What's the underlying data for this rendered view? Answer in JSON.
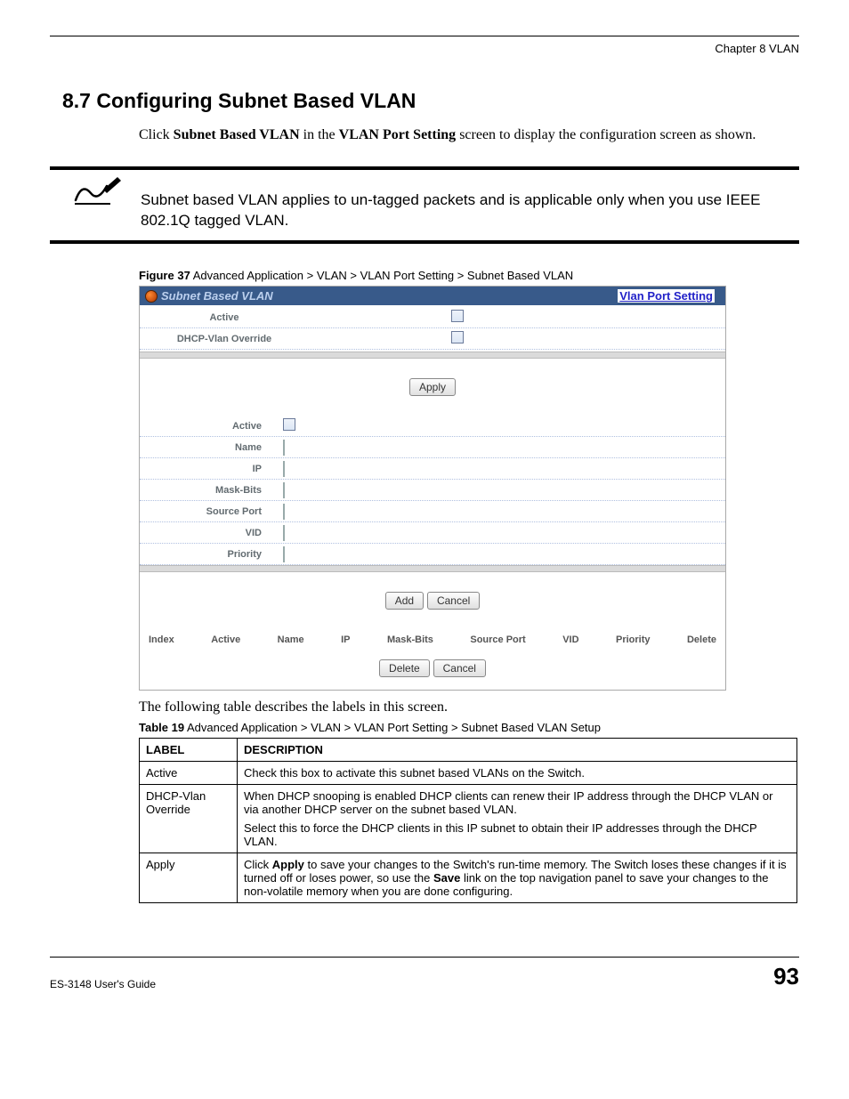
{
  "header": {
    "chapter": "Chapter 8 VLAN"
  },
  "section": {
    "number_title": "8.7  Configuring Subnet Based VLAN",
    "intro_click": "Click ",
    "intro_bold1": "Subnet Based VLAN",
    "intro_mid": " in the ",
    "intro_bold2": "VLAN Port Setting",
    "intro_tail": " screen to display the configuration screen as shown."
  },
  "note": {
    "text": "Subnet based VLAN applies to un-tagged packets and is applicable only when you use IEEE 802.1Q tagged VLAN."
  },
  "figure": {
    "label": "Figure 37",
    "caption": "   Advanced Application > VLAN > VLAN Port Setting > Subnet Based VLAN"
  },
  "screenshot": {
    "title_left": "Subnet Based VLAN",
    "title_right": "Vlan Port Setting",
    "form1": {
      "r1": "Active",
      "r2": "DHCP-Vlan Override"
    },
    "btn_apply": "Apply",
    "form2": {
      "r1": "Active",
      "r2": "Name",
      "r3": "IP",
      "r4": "Mask-Bits",
      "r5": "Source Port",
      "r6": "VID",
      "r7": "Priority"
    },
    "btn_add": "Add",
    "btn_cancel": "Cancel",
    "tbl_headers": {
      "c1": "Index",
      "c2": "Active",
      "c3": "Name",
      "c4": "IP",
      "c5": "Mask-Bits",
      "c6": "Source Port",
      "c7": "VID",
      "c8": "Priority",
      "c9": "Delete"
    },
    "btn_delete": "Delete",
    "btn_cancel2": "Cancel"
  },
  "post_figure_text": "The following table describes the labels in this screen.",
  "table_caption": {
    "label": "Table 19",
    "text": "   Advanced Application > VLAN > VLAN Port Setting > Subnet Based VLAN Setup"
  },
  "table": {
    "h1": "LABEL",
    "h2": "DESCRIPTION",
    "rows": [
      {
        "label": "Active",
        "desc_p1": "Check this box to activate this subnet based VLANs on the Switch."
      },
      {
        "label": "DHCP-Vlan Override",
        "desc_p1": "When DHCP snooping is enabled DHCP clients can renew their IP address through the DHCP VLAN or via another DHCP server on the subnet based VLAN.",
        "desc_p2": "Select this to force the DHCP clients in this IP subnet to obtain their IP addresses through the DHCP VLAN."
      },
      {
        "label": "Apply",
        "desc_pre": "Click ",
        "desc_b1": "Apply",
        "desc_mid": " to save your changes to the Switch's run-time memory. The Switch loses these changes if it is turned off or loses power, so use the ",
        "desc_b2": "Save",
        "desc_post": " link on the top navigation panel to save your changes to the non-volatile memory when you are done configuring."
      }
    ]
  },
  "footer": {
    "guide": "ES-3148 User's Guide",
    "page": "93"
  }
}
